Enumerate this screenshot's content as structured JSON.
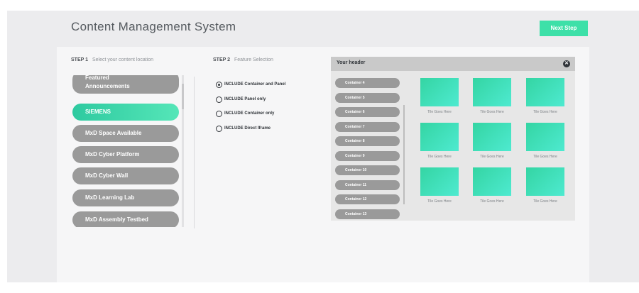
{
  "app": {
    "title": "Content Management System",
    "next_step_label": "Next Step"
  },
  "step1": {
    "number": "STEP 1",
    "text": "Select your content location"
  },
  "step2": {
    "number": "STEP 2",
    "text": "Feature Selection"
  },
  "locations": [
    {
      "line1": "Featured",
      "line2": "Announcements",
      "active": false
    },
    {
      "line1": "SIEMENS",
      "line2": "",
      "active": true
    },
    {
      "line1": "MxD Space Available",
      "line2": "",
      "active": false
    },
    {
      "line1": "MxD Cyber Platform",
      "line2": "",
      "active": false
    },
    {
      "line1": "MxD Cyber Wall",
      "line2": "",
      "active": false
    },
    {
      "line1": "MxD Learning Lab",
      "line2": "",
      "active": false
    },
    {
      "line1": "MxD Assembly Testbed",
      "line2": "",
      "active": false
    }
  ],
  "feature_options": [
    {
      "label": "INCLUDE Container and Panel",
      "selected": true
    },
    {
      "label": "INCLUDE Panel only",
      "selected": false
    },
    {
      "label": "INCLUDE Container only",
      "selected": false
    },
    {
      "label": "INCLUDE Direct Iframe",
      "selected": false
    }
  ],
  "preview": {
    "header": "Your header",
    "containers": [
      "Container 4",
      "Container 5",
      "Container 6",
      "Container 7",
      "Container 8",
      "Container 9",
      "Container 10",
      "Container 11",
      "Container 12",
      "Container 13"
    ],
    "tile_label": "Tile Goes Here",
    "tile_count": 9
  },
  "colors": {
    "accent": "#3de0a8",
    "pill_gray": "#9a9a9a",
    "tile_start": "#34d5a3",
    "tile_end": "#4eead0"
  }
}
